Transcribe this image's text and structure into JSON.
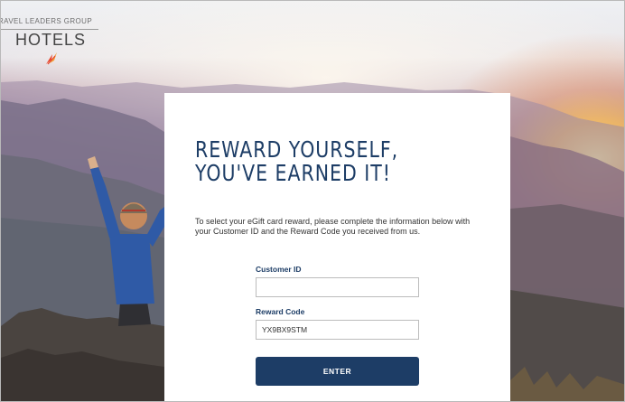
{
  "brand": {
    "tagline": "RAVEL LEADERS GROUP",
    "name": "HOTELS"
  },
  "card": {
    "headline_line1": "REWARD YOURSELF,",
    "headline_line2": "YOU'VE EARNED IT!",
    "intro": "To select your eGift card reward, please complete the information below with your Customer ID and the Reward Code you received from us.",
    "customer_id_label": "Customer ID",
    "customer_id_value": "",
    "reward_code_label": "Reward Code",
    "reward_code_value": "YX9BX9STM",
    "submit_label": "ENTER"
  },
  "colors": {
    "brand_navy": "#1d3d66",
    "logo_mark_red": "#e8452c",
    "logo_mark_orange": "#f2a03a"
  },
  "icons": {
    "logo_mark": "swoosh-arrow-icon",
    "scene": "mountain-sunrise-hiker-image"
  }
}
